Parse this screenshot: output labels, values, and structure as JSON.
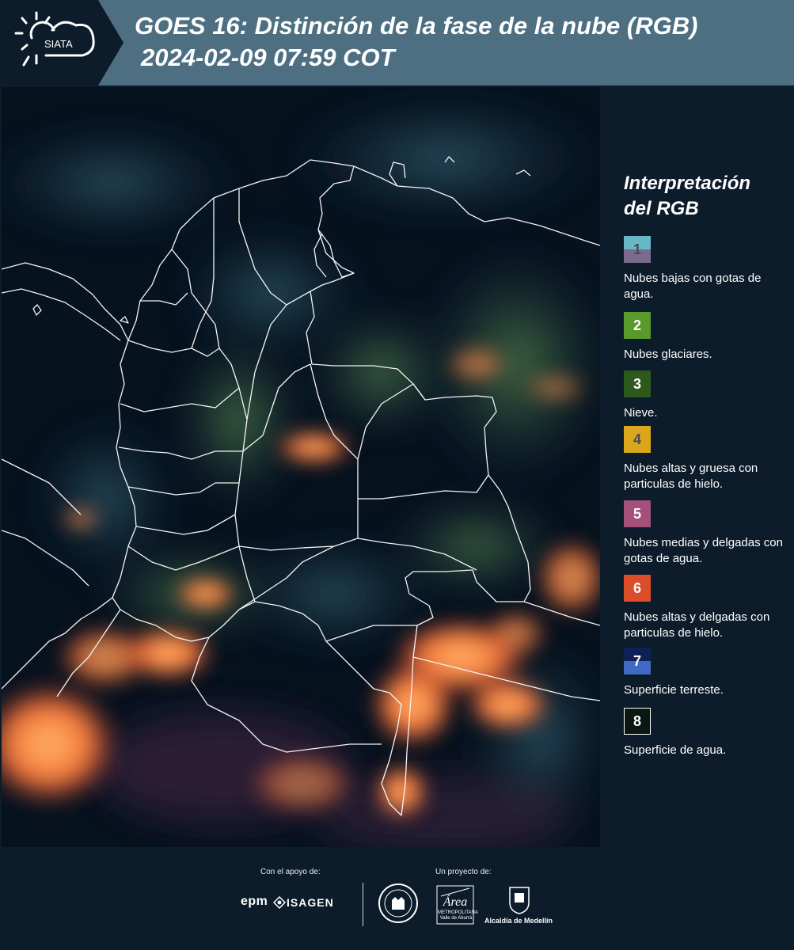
{
  "header": {
    "logo_text": "SIATA",
    "title": "GOES 16: Distinción de la fase de la nube (RGB)",
    "subtitle": "2024-02-09 07:59 COT"
  },
  "legend": {
    "title": "Interpretación del RGB",
    "items": [
      {
        "number": "1",
        "label": "Nubes bajas con gotas de agua.",
        "color_top": "#67b7c6",
        "color_bottom": "#7b6c8e",
        "num_color": "#4a4a55"
      },
      {
        "number": "2",
        "label": "Nubes glaciares.",
        "color": "#5a9a2d",
        "num_color": "#ffffff"
      },
      {
        "number": "3",
        "label": "Nieve.",
        "color": "#2d5a1c",
        "num_color": "#ffffff"
      },
      {
        "number": "4",
        "label": "Nubes altas y gruesa con particulas de hielo.",
        "color": "#d9a61c",
        "num_color": "#4a4a55"
      },
      {
        "number": "5",
        "label": "Nubes medias y delgadas con gotas de agua.",
        "color": "#a4507b",
        "num_color": "#ffffff"
      },
      {
        "number": "6",
        "label": "Nubes altas y delgadas con particulas de hielo.",
        "color": "#dc4d2a",
        "num_color": "#ffffff"
      },
      {
        "number": "7",
        "label": "Superficie terreste.",
        "color_top": "#0e2157",
        "color_bottom": "#3f6bc4",
        "num_color": "#ffffff"
      },
      {
        "number": "8",
        "label": "Superficie de agua.",
        "color": "#0a1712",
        "num_color": "#ffffff",
        "border": "#ffffff"
      }
    ]
  },
  "footer": {
    "support_label": "Con el apoyo de:",
    "project_label": "Un proyecto de:",
    "sponsors": [
      "epm",
      "ISAGEN"
    ],
    "partners": [
      "Área Metropolitana Valle de Aburrá",
      "Alcaldía de Medellín"
    ],
    "area_logo_text": "Área",
    "area_logo_subtext": "METROPOLITANA Valle de Aburrá",
    "alcaldia_label": "Alcaldía de Medellín"
  },
  "colors": {
    "header_bg": "#4d6f81",
    "page_bg": "#0c1c2a",
    "ice_cloud_orange": "#f57a3c"
  }
}
